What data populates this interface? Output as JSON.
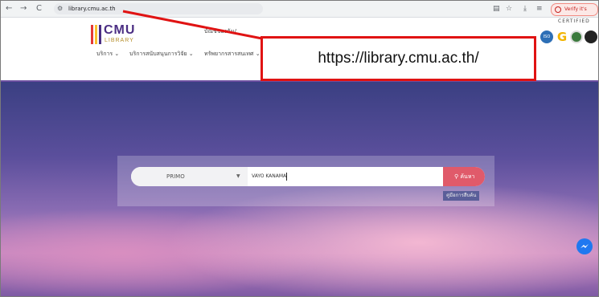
{
  "browser": {
    "back_icon": "←",
    "forward_icon": "→",
    "reload_icon": "C",
    "url": "library.cmu.ac.th",
    "verify_label": "Verify it's you"
  },
  "site": {
    "logo_title": "CMU",
    "logo_sub": "LIBRARY",
    "logo_colors": [
      "#e53935",
      "#fbc02d",
      "#4b2e83"
    ],
    "account_label": "บัณชีของฉัน/",
    "menu": [
      {
        "label": "บริการ"
      },
      {
        "label": "บริการสนับสนุนการวิจัย"
      },
      {
        "label": "ทรัพยากรสารสนเทศ"
      }
    ],
    "certified_label": "CERTIFIED",
    "badge_iso": "ISO"
  },
  "search": {
    "scope_value": "PRIMO",
    "query_value": "VAYO KANAMA",
    "button_label": "ค้นหา",
    "guide_label": "คู่มือการสืบค้น"
  },
  "annotation": {
    "text": "https://library.cmu.ac.th/",
    "color": "#e01313"
  }
}
